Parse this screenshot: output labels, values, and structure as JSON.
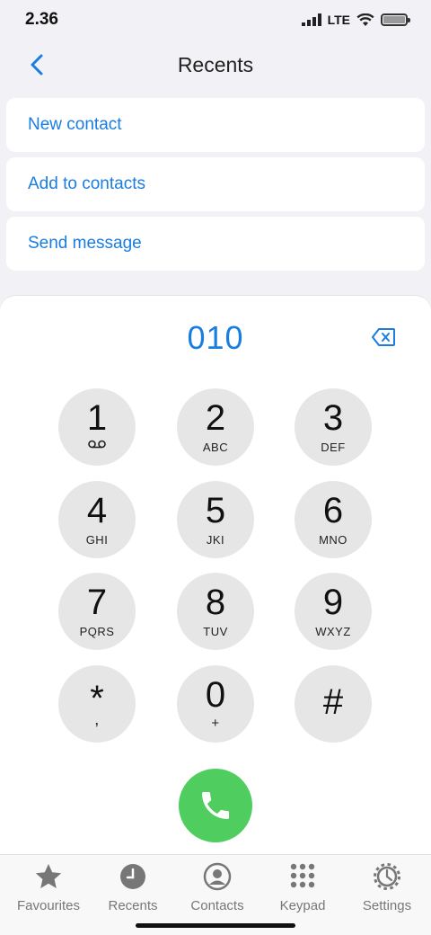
{
  "status": {
    "time": "2.36",
    "network": "LTE"
  },
  "header": {
    "title": "Recents"
  },
  "actions": [
    {
      "label": "New contact"
    },
    {
      "label": "Add to contacts"
    },
    {
      "label": "Send message"
    }
  ],
  "dialer": {
    "number": "010",
    "keys": [
      {
        "digit": "1",
        "letters": ""
      },
      {
        "digit": "2",
        "letters": "ABC"
      },
      {
        "digit": "3",
        "letters": "DEF"
      },
      {
        "digit": "4",
        "letters": "GHI"
      },
      {
        "digit": "5",
        "letters": "JKI"
      },
      {
        "digit": "6",
        "letters": "MNO"
      },
      {
        "digit": "7",
        "letters": "PQRS"
      },
      {
        "digit": "8",
        "letters": "TUV"
      },
      {
        "digit": "9",
        "letters": "WXYZ"
      },
      {
        "digit": "*",
        "letters": ","
      },
      {
        "digit": "0",
        "letters": "+"
      },
      {
        "digit": "#",
        "letters": ""
      }
    ]
  },
  "tabs": [
    {
      "label": "Favourites",
      "icon": "star-icon"
    },
    {
      "label": "Recents",
      "icon": "clock-icon"
    },
    {
      "label": "Contacts",
      "icon": "person-icon"
    },
    {
      "label": "Keypad",
      "icon": "keypad-icon"
    },
    {
      "label": "Settings",
      "icon": "gear-icon"
    }
  ],
  "colors": {
    "accent": "#1a7de0",
    "call": "#4fcd5f",
    "key_bg": "#e6e6e6",
    "tab_icon": "#777777"
  }
}
